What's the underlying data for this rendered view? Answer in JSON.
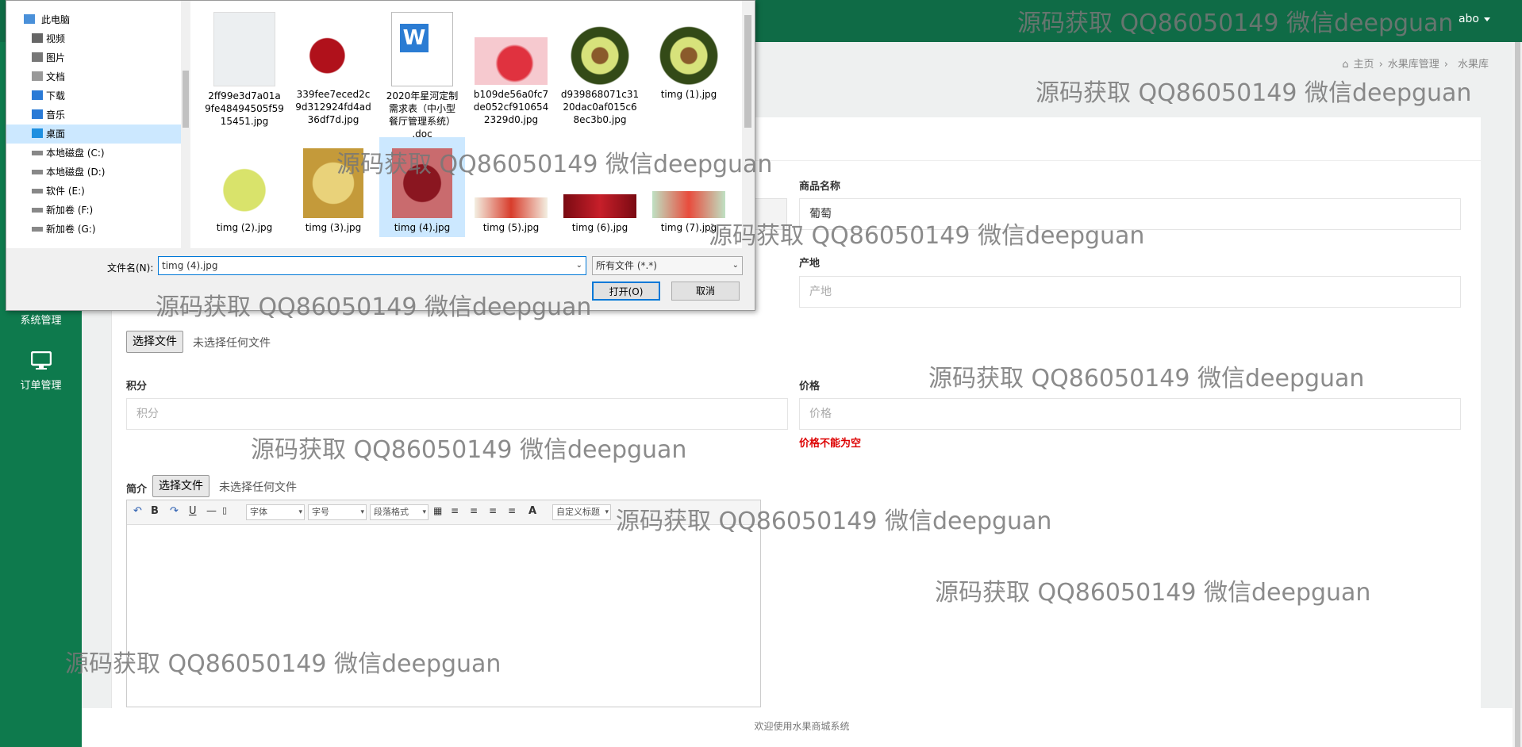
{
  "header": {
    "user": "abo"
  },
  "breadcrumb": {
    "home": "主页",
    "level1": "水果库管理",
    "level2": "水果库"
  },
  "sidebar": {
    "items": [
      {
        "label": "系统管理",
        "icon": "user-icon"
      },
      {
        "label": "订单管理",
        "icon": "monitor-icon"
      }
    ]
  },
  "form": {
    "product_name_label": "商品名称",
    "product_name_value": "葡萄",
    "origin_label": "产地",
    "origin_placeholder": "产地",
    "choose_file": "选择文件",
    "no_file": "未选择任何文件",
    "points_label": "积分",
    "points_placeholder": "积分",
    "price_label": "价格",
    "price_placeholder": "价格",
    "price_error": "价格不能为空",
    "intro_label": "简介",
    "intro_choose_file": "选择文件",
    "intro_no_file": "未选择任何文件"
  },
  "editor": {
    "font_select": "字体",
    "size_select": "字号",
    "para_select": "段落格式",
    "custom_select": "自定义标题"
  },
  "footer": {
    "text": "欢迎使用水果商城系统"
  },
  "dialog": {
    "tree": [
      {
        "label": "此电脑",
        "icon": "computer-icon"
      },
      {
        "label": "视频",
        "icon": "video-icon"
      },
      {
        "label": "图片",
        "icon": "picture-icon"
      },
      {
        "label": "文档",
        "icon": "document-icon"
      },
      {
        "label": "下载",
        "icon": "download-icon"
      },
      {
        "label": "音乐",
        "icon": "music-icon"
      },
      {
        "label": "桌面",
        "icon": "desktop-icon"
      },
      {
        "label": "本地磁盘 (C:)",
        "icon": "drive-icon"
      },
      {
        "label": "本地磁盘 (D:)",
        "icon": "drive-icon"
      },
      {
        "label": "软件 (E:)",
        "icon": "drive-icon"
      },
      {
        "label": "新加卷 (F:)",
        "icon": "drive-icon"
      },
      {
        "label": "新加卷 (G:)",
        "icon": "drive-icon"
      }
    ],
    "files": [
      {
        "name": "2ff99e3d7a01a9fe48494505f5915451.jpg",
        "lines": [
          "2ff99e3d7a01a",
          "9fe48494505f59",
          "15451.jpg"
        ]
      },
      {
        "name": "339fee7eced2c9d312924fd4ad36df7d.jpg",
        "lines": [
          "339fee7eced2c",
          "9d312924fd4ad",
          "36df7d.jpg"
        ]
      },
      {
        "name": "2020年星河定制需求表（中小型餐厅管理系统）.doc",
        "lines": [
          "2020年星河定制",
          "需求表（中小型",
          "餐厅管理系统）",
          ".doc"
        ]
      },
      {
        "name": "b109de56a0fc7de052cf9106542329d0.jpg",
        "lines": [
          "b109de56a0fc7",
          "de052cf910654",
          "2329d0.jpg"
        ]
      },
      {
        "name": "d939868071c3120dac0af015c68ec3b0.jpg",
        "lines": [
          "d939868071c31",
          "20dac0af015c6",
          "8ec3b0.jpg"
        ]
      },
      {
        "name": "timg (1).jpg",
        "lines": [
          "timg (1).jpg"
        ]
      },
      {
        "name": "timg (2).jpg",
        "lines": [
          "timg (2).jpg"
        ]
      },
      {
        "name": "timg (3).jpg",
        "lines": [
          "timg (3).jpg"
        ]
      },
      {
        "name": "timg (4).jpg",
        "lines": [
          "timg (4).jpg"
        ]
      },
      {
        "name": "timg (5).jpg",
        "lines": [
          "timg (5).jpg"
        ]
      },
      {
        "name": "timg (6).jpg",
        "lines": [
          "timg (6).jpg"
        ]
      },
      {
        "name": "timg (7).jpg",
        "lines": [
          "timg (7).jpg"
        ]
      }
    ],
    "filename_label": "文件名(N):",
    "filename_value": "timg (4).jpg",
    "filetype_value": "所有文件 (*.*)",
    "open_button": "打开(O)",
    "cancel_button": "取消"
  },
  "watermark": "源码获取 QQ86050149 微信deepguan"
}
